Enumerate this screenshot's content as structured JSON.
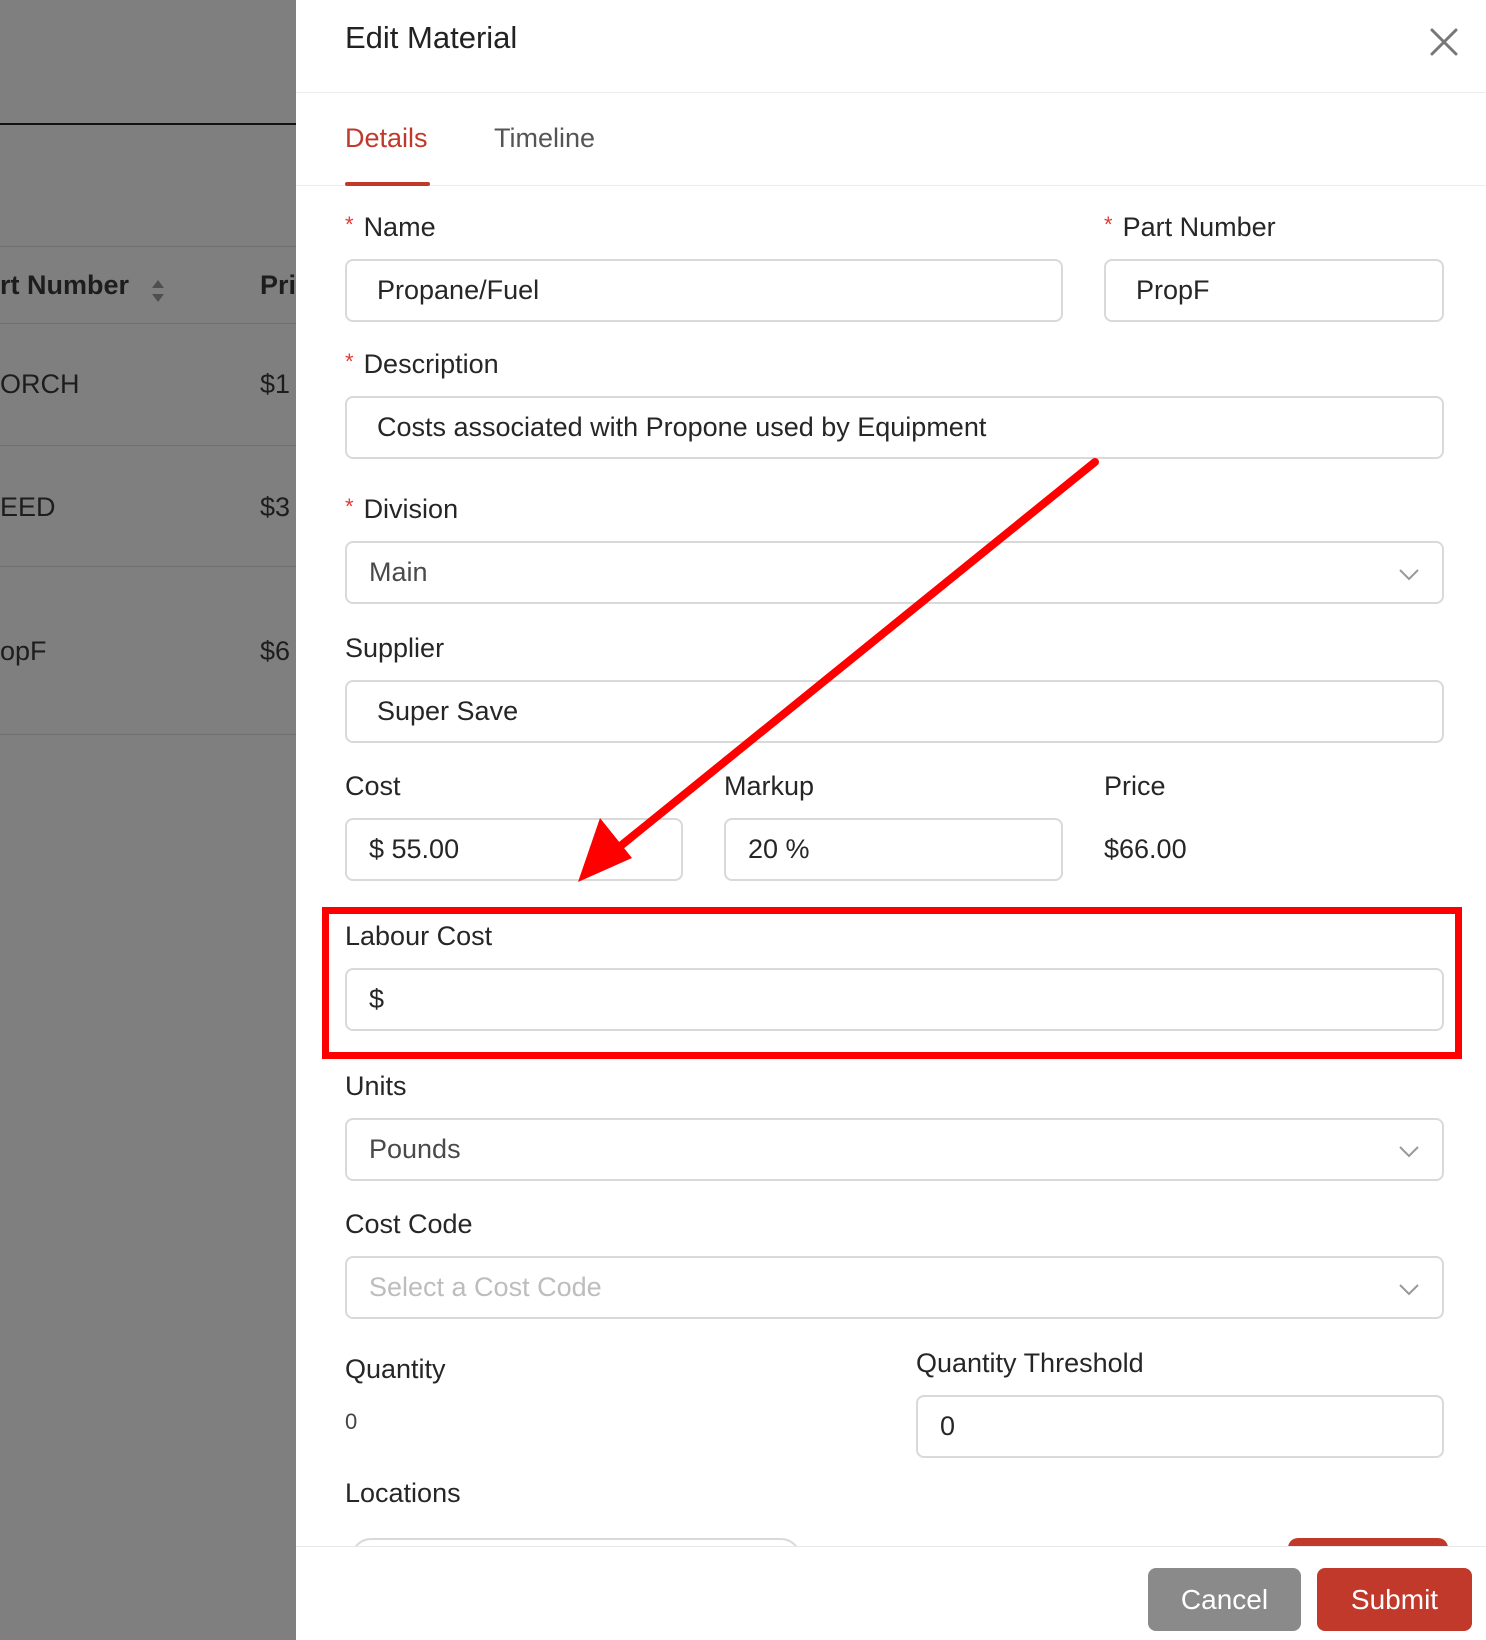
{
  "background_table": {
    "header_part_number": "rt Number",
    "header_price": "Pri",
    "rows": [
      {
        "part": "ORCH",
        "price": "$1"
      },
      {
        "part": "EED",
        "price": "$3"
      },
      {
        "part": "opF",
        "price": "$6"
      }
    ]
  },
  "drawer": {
    "title": "Edit Material",
    "tabs": [
      {
        "label": "Details",
        "active": true
      },
      {
        "label": "Timeline",
        "active": false
      }
    ]
  },
  "form": {
    "name": {
      "label": "Name",
      "required_mark": "*",
      "value": "Propane/Fuel"
    },
    "part_number": {
      "label": "Part Number",
      "required_mark": "*",
      "value": "PropF"
    },
    "description": {
      "label": "Description",
      "required_mark": "*",
      "value": "Costs associated with Propone used by Equipment"
    },
    "division": {
      "label": "Division",
      "required_mark": "*",
      "value": "Main"
    },
    "supplier": {
      "label": "Supplier",
      "value": "Super Save"
    },
    "cost": {
      "label": "Cost",
      "value": "$ 55.00"
    },
    "markup": {
      "label": "Markup",
      "value": "20 %"
    },
    "price": {
      "label": "Price",
      "value": "$66.00"
    },
    "labour_cost": {
      "label": "Labour Cost",
      "value": "$"
    },
    "units": {
      "label": "Units",
      "value": "Pounds"
    },
    "cost_code": {
      "label": "Cost Code",
      "placeholder": "Select a Cost Code"
    },
    "quantity": {
      "label": "Quantity",
      "value": "0"
    },
    "quantity_threshold": {
      "label": "Quantity Threshold",
      "value": "0"
    },
    "locations": {
      "label": "Locations"
    }
  },
  "footer": {
    "cancel_label": "Cancel",
    "submit_label": "Submit"
  },
  "colors": {
    "accent": "#c0392b",
    "highlight": "#ff0000",
    "required": "#e53935",
    "cancel_button": "#8a8a8a"
  },
  "icons": [
    "close-icon",
    "chevron-down-icon",
    "sort-icon"
  ]
}
